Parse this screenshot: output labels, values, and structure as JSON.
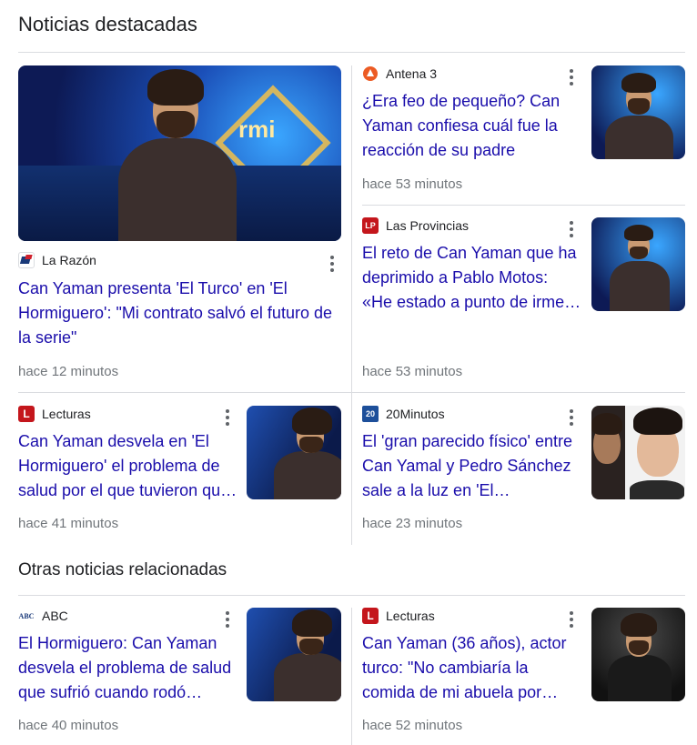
{
  "sections": {
    "top_title": "Noticias destacadas",
    "related_title": "Otras noticias relacionadas"
  },
  "articles": [
    {
      "source": "La Razón",
      "logo_text": "",
      "headline": "Can Yaman presenta 'El Turco' en 'El Hormiguero': \"Mi contrato salvó el futuro de la serie\"",
      "time": "hace 12 minutos"
    },
    {
      "source": "Antena 3",
      "logo_text": "",
      "headline": "¿Era feo de pequeño? Can Yaman confiesa cuál fue la reacción de su padre cuando…",
      "time": "hace 53 minutos"
    },
    {
      "source": "Las Provincias",
      "logo_text": "LP",
      "headline": "El reto de Can Yaman que ha deprimido a Pablo Motos: «He estado a punto de irme…",
      "time": "hace 53 minutos"
    },
    {
      "source": "Lecturas",
      "logo_text": "L",
      "headline": "Can Yaman desvela en 'El Hormiguero' el problema de salud por el que tuvieron qu…",
      "time": "hace 41 minutos"
    },
    {
      "source": "20Minutos",
      "logo_text": "20",
      "headline": "El 'gran parecido físico' entre Can Yamal y Pedro Sánchez sale a la luz en 'El…",
      "time": "hace 23 minutos"
    },
    {
      "source": "ABC",
      "logo_text": "ABC",
      "headline": "El Hormiguero: Can Yaman desvela el problema de salud que sufrió cuando rodó…",
      "time": "hace 40 minutos"
    },
    {
      "source": "Lecturas",
      "logo_text": "L",
      "headline": "Can Yaman (36 años), actor turco: \"No cambiaría la comida de mi abuela por…",
      "time": "hace 52 minutos"
    }
  ],
  "colors": {
    "link": "#1a0dab",
    "meta": "#70757a",
    "divider": "#dadce0"
  }
}
